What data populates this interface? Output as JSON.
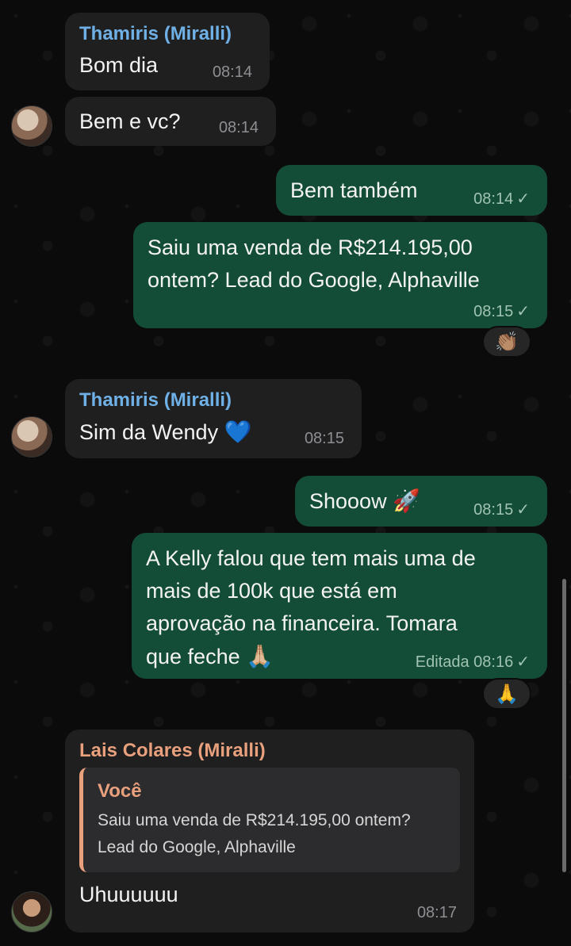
{
  "messages": [
    {
      "sender": "Thamiris (Miralli)",
      "text": "Bom dia",
      "time": "08:14"
    },
    {
      "text": "Bem e vc?",
      "time": "08:14"
    },
    {
      "text": "Bem também",
      "time": "08:14",
      "status": "✓"
    },
    {
      "text_line1": "Saiu uma venda de R$214.195,00",
      "text_line2": "ontem? Lead do Google, Alphaville",
      "time": "08:15",
      "status": "✓",
      "reaction": "👏🏽"
    },
    {
      "sender": "Thamiris (Miralli)",
      "text": "Sim da Wendy",
      "emoji": "💙",
      "time": "08:15"
    },
    {
      "text": "Shooow",
      "emoji": "🚀",
      "time": "08:15",
      "status": "✓"
    },
    {
      "line1": "A Kelly falou que tem mais uma de",
      "line2": "mais de 100k que está em",
      "line3": "aprovação na financeira. Tomara",
      "line4": "que feche",
      "emoji": "🙏🏼",
      "edited": "Editada",
      "time": "08:16",
      "status": "✓",
      "reaction": "🙏"
    },
    {
      "sender": "Lais Colares (Miralli)",
      "quote_name": "Você",
      "quote_line1": "Saiu uma venda de R$214.195,00 ontem?",
      "quote_line2": "Lead do Google, Alphaville",
      "text": "Uhuuuuuu",
      "time": "08:17"
    }
  ],
  "colors": {
    "background": "#0b0b0b",
    "incoming_bubble": "#1f1f1f",
    "outgoing_bubble": "#144d37",
    "thamiris_name": "#6fb1e6",
    "lais_name": "#e9a07d"
  }
}
